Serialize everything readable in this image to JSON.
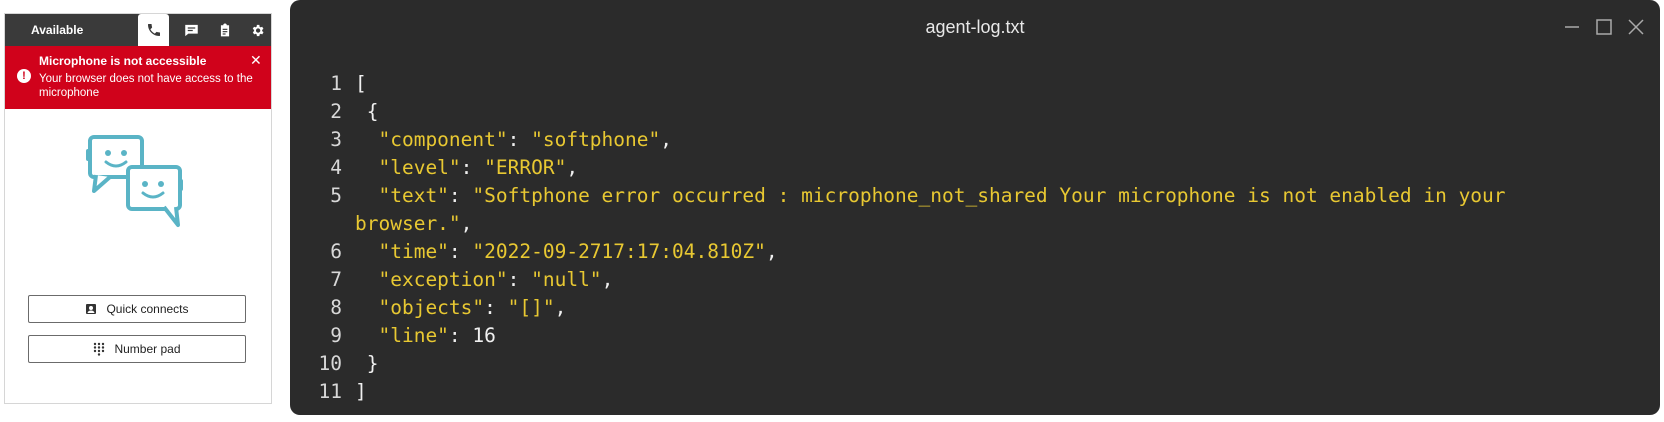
{
  "ccp": {
    "status": "Available",
    "tabs": {
      "phone": "phone-icon",
      "chat": "chat-icon",
      "tasks": "clipboard-icon",
      "settings": "gear-icon"
    },
    "alert": {
      "title": "Microphone is not accessible",
      "body": "Your browser does not have access to the microphone",
      "close": "✕"
    },
    "buttons": {
      "quick_connects": "Quick connects",
      "number_pad": "Number pad"
    },
    "colors": {
      "header": "#3a3a3a",
      "alert": "#d0021b",
      "illustration": "#5ab4c6"
    }
  },
  "log_window": {
    "title": "agent-log.txt",
    "lines": [
      {
        "n": "1",
        "key": "",
        "sep": "",
        "val": "",
        "raw": "["
      },
      {
        "n": "2",
        "key": "",
        "sep": "",
        "val": "",
        "raw": " {"
      },
      {
        "n": "3",
        "key": "  \"component\"",
        "sep": ": ",
        "val": "\"softphone\"",
        "raw": ","
      },
      {
        "n": "4",
        "key": "  \"level\"",
        "sep": ": ",
        "val": "\"ERROR\"",
        "raw": ","
      },
      {
        "n": "5",
        "key": "  \"text\"",
        "sep": ": ",
        "val": "\"Softphone error occurred : microphone_not_shared Your microphone is not enabled in your",
        "raw": ""
      },
      {
        "n": "",
        "key": "",
        "sep": "",
        "val": "browser.\"",
        "raw": ","
      },
      {
        "n": "6",
        "key": "  \"time\"",
        "sep": ": ",
        "val": "\"2022-09-2717:17:04.810Z\"",
        "raw": ","
      },
      {
        "n": "7",
        "key": "  \"exception\"",
        "sep": ": ",
        "val": "\"null\"",
        "raw": ","
      },
      {
        "n": "8",
        "key": "  \"objects\"",
        "sep": ": ",
        "val": "\"[]\"",
        "raw": ","
      },
      {
        "n": "9",
        "key": "  \"line\"",
        "sep": ": ",
        "val": "",
        "raw": "16"
      },
      {
        "n": "10",
        "key": "",
        "sep": "",
        "val": "",
        "raw": " }"
      },
      {
        "n": "11",
        "key": "",
        "sep": "",
        "val": "",
        "raw": "]"
      }
    ],
    "colors": {
      "background": "#2b2b2b",
      "string": "#e8c832",
      "text": "#f0f0f0"
    }
  }
}
